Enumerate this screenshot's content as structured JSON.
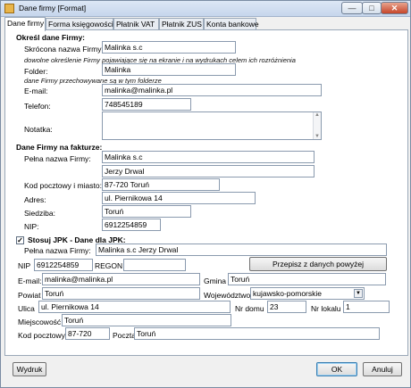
{
  "window": {
    "title": "Dane firmy [Format]",
    "min_glyph": "—",
    "max_glyph": "□",
    "close_glyph": "✕"
  },
  "tabs": [
    {
      "label": "Dane firmy"
    },
    {
      "label": "Forma księgowości"
    },
    {
      "label": "Płatnik VAT"
    },
    {
      "label": "Płatnik ZUS"
    },
    {
      "label": "Konta bankowe"
    }
  ],
  "section1": {
    "header": "Określ dane Firmy:",
    "short_name_label": "Skrócona nazwa Firmy:",
    "short_name_value": "Malinka s.c",
    "short_name_note": "dowolne określenie Firmy pojawiające się na ekranie i na wydrukach celem ich rozróżnienia",
    "folder_label": "Folder:",
    "folder_value": "Malinka",
    "folder_note": "dane Firmy przechowywane są w tym folderze",
    "email_label": "E-mail:",
    "email_value": "malinka@malinka.pl",
    "phone_label": "Telefon:",
    "phone_value": "748545189",
    "notes_label": "Notatka:",
    "notes_value": ""
  },
  "section2": {
    "header": "Dane Firmy na fakturze:",
    "full_name_label": "Pełna nazwa Firmy:",
    "full_name_line1": "Malinka s.c",
    "full_name_line2": "Jerzy Drwal",
    "postal_city_label": "Kod pocztowy i miasto:",
    "postal_city_value": "87-720 Toruń",
    "address_label": "Adres:",
    "address_value": "ul. Piernikowa 14",
    "seat_label": "Siedziba:",
    "seat_value": "Toruń",
    "nip_label": "NIP:",
    "nip_value": "6912254859"
  },
  "jpk": {
    "checkbox_checked": true,
    "checkbox_glyph": "✓",
    "header": "Stosuj JPK - Dane dla JPK:",
    "full_name_label": "Pełna nazwa Firmy:",
    "full_name_value": "Malinka s.c  Jerzy Drwal",
    "nip_label": "NIP",
    "nip_value": "6912254859",
    "regon_label": "REGON",
    "regon_value": "",
    "copy_button": "Przepisz z danych powyżej",
    "email_label": "E-mail:",
    "email_value": "malinka@malinka.pl",
    "gmina_label": "Gmina",
    "gmina_value": "Toruń",
    "powiat_label": "Powiat",
    "powiat_value": "Toruń",
    "woj_label": "Województwo",
    "woj_value": "kujawsko-pomorskie",
    "street_label": "Ulica",
    "street_value": "ul. Piernikowa 14",
    "house_label": "Nr domu",
    "house_value": "23",
    "flat_label": "Nr lokalu",
    "flat_value": "1",
    "town_label": "Miejscowość",
    "town_value": "Toruń",
    "postal_label": "Kod pocztowy",
    "postal_value": "87-720",
    "post_label": "Poczta",
    "post_value": "Toruń"
  },
  "footer": {
    "print_button": "Wydruk",
    "ok_button": "OK",
    "cancel_button": "Anuluj"
  }
}
